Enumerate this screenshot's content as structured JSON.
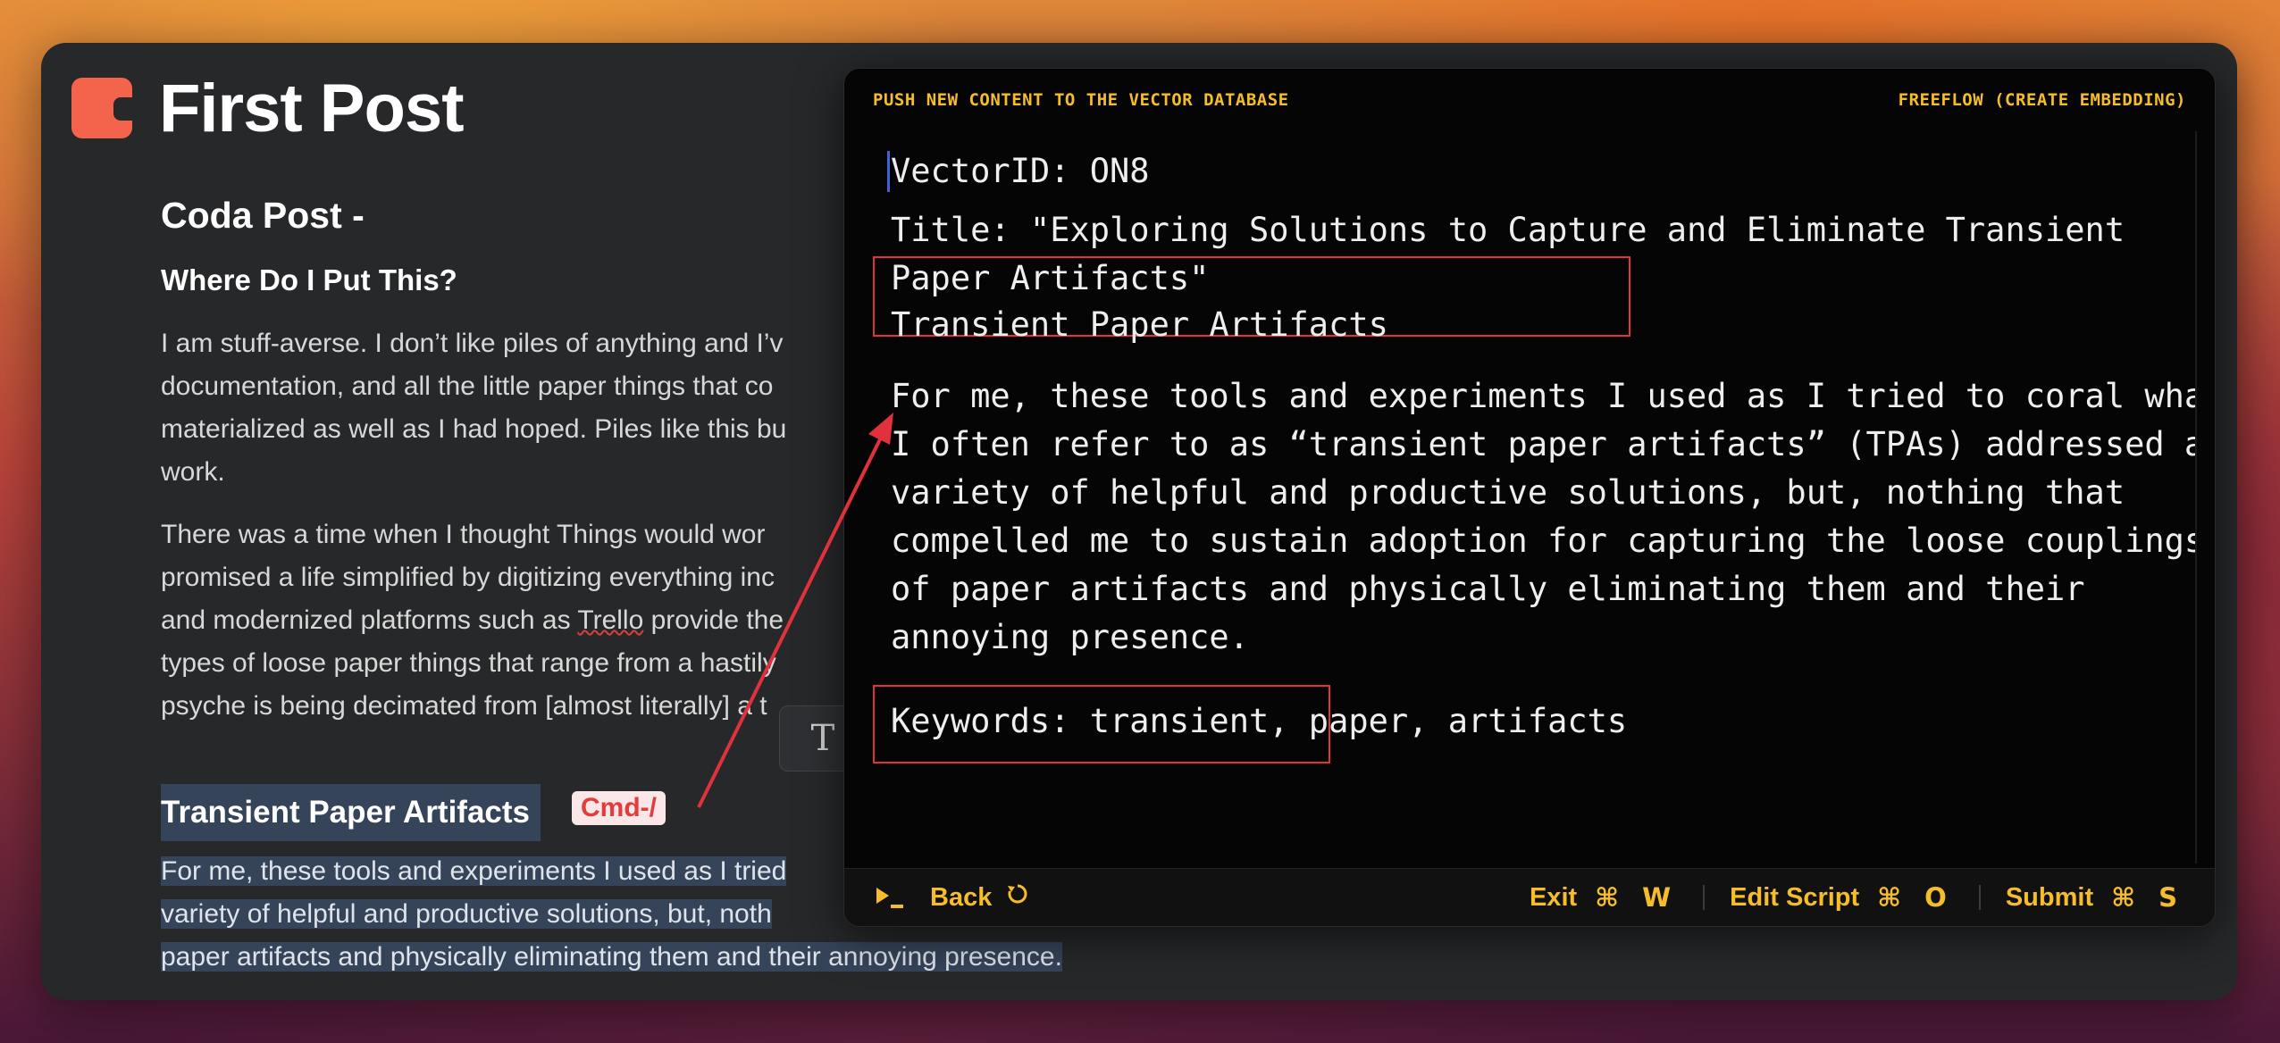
{
  "document": {
    "title": "First Post",
    "heading": "Coda Post -",
    "subheading": "Where Do I Put This?",
    "para1_lines": [
      "I am stuff-averse. I don’t like piles of anything and I’v",
      "documentation, and all the little paper things that co",
      "materialized as well as I had hoped. Piles like this bu",
      "work."
    ],
    "para2_lines": [
      "There was a time when I thought Things would wor",
      "promised a life simplified by digitizing everything inc",
      "and modernized platforms such as ",
      "Trello",
      " provide the",
      "types of loose paper things that range from a hastily",
      "psyche is being decimated from [almost literally] a t"
    ],
    "section_heading": "Transient Paper Artifacts",
    "shortcut_badge": "Cmd-/",
    "section_body_lines": [
      "For me, these tools and experiments I used as I tried",
      "variety of helpful and productive solutions, but, noth",
      "paper artifacts and physically eliminating them and ",
      "their annoying presence."
    ],
    "format_button": "T"
  },
  "panel": {
    "header_left": "PUSH NEW CONTENT TO THE VECTOR DATABASE",
    "header_right": "FREEFLOW (CREATE EMBEDDING)",
    "lines": [
      "VectorID: ON8",
      "Title: \"Exploring Solutions to Capture and Eliminate Transient",
      "Paper Artifacts\"",
      "Transient Paper Artifacts",
      "For me, these tools and experiments I used as I tried to coral what",
      "I often refer to as “transient paper artifacts” (TPAs) addressed a",
      "variety of helpful and productive solutions, but, nothing that",
      "compelled me to sustain adoption for capturing the loose couplings",
      "of paper artifacts and physically eliminating them and their",
      "annoying presence.",
      "Keywords: transient, paper, artifacts"
    ],
    "footer": {
      "back_label": "Back",
      "exit_label": "Exit",
      "exit_keys": "⌘ W",
      "edit_label": "Edit Script",
      "edit_keys": "⌘ O",
      "submit_label": "Submit",
      "submit_keys": "⌘ S"
    }
  },
  "colors": {
    "accent_yellow": "#f5bd2a",
    "highlight_red": "#e0313c",
    "selection_blue": "#36445a",
    "coda_orange": "#f4634c"
  }
}
